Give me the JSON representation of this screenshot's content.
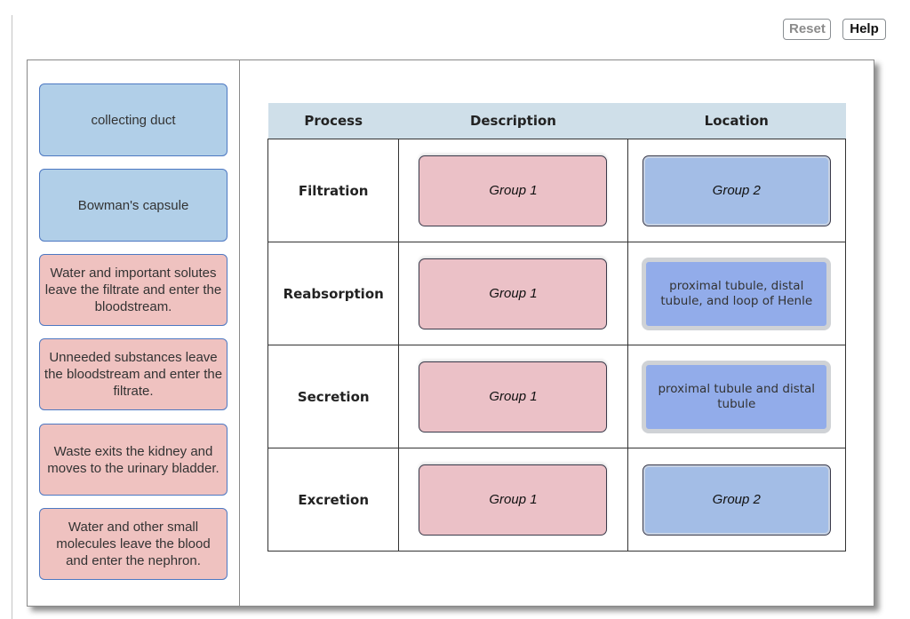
{
  "toolbar": {
    "reset_label": "Reset",
    "help_label": "Help"
  },
  "palette": {
    "items": [
      {
        "label": "collecting duct",
        "type": "term"
      },
      {
        "label": "Bowman's capsule",
        "type": "term"
      },
      {
        "label": "Water and important solutes leave the filtrate and enter the bloodstream.",
        "type": "description"
      },
      {
        "label": "Unneeded substances leave the bloodstream and enter the filtrate.",
        "type": "description"
      },
      {
        "label": "Waste exits the kidney and moves to the urinary bladder.",
        "type": "description"
      },
      {
        "label": "Water and other small molecules leave the blood and enter the nephron.",
        "type": "description"
      }
    ]
  },
  "table": {
    "headers": [
      "Process",
      "Description",
      "Location"
    ],
    "rows": [
      {
        "process": "Filtration",
        "description": "Group 1",
        "location": "Group 2",
        "location_filled": false
      },
      {
        "process": "Reabsorption",
        "description": "Group 1",
        "location": "proximal tubule, distal tubule, and loop of Henle",
        "location_filled": true
      },
      {
        "process": "Secretion",
        "description": "Group 1",
        "location": "proximal tubule and distal tubule",
        "location_filled": true
      },
      {
        "process": "Excretion",
        "description": "Group 1",
        "location": "Group 2",
        "location_filled": false
      }
    ]
  },
  "colors": {
    "term_card": "#b1cfe8",
    "description_card": "#efc2c0",
    "group1_target": "#ebc1c7",
    "group2_target": "#a3bde6",
    "placed_label": "#92acea",
    "header_bg": "#cfdfe9"
  }
}
